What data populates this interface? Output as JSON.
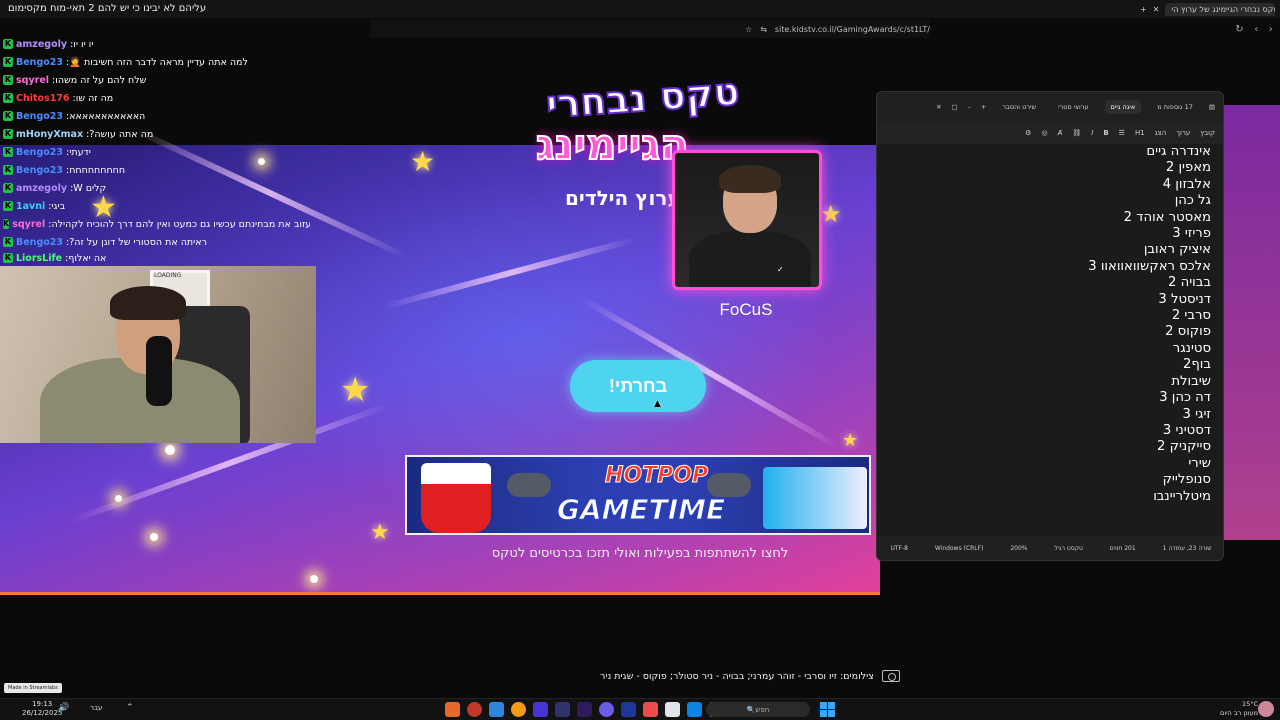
{
  "stream": {
    "title": "עליהם לא יבינו כי יש להם 2 תאי-מוח מקסימום",
    "credits": "צילומים: זיו וסרבי - זוהר עמרני; בבויה - ניר סטולר; פוקוס - שגית ניר"
  },
  "browser": {
    "tab_title": "טקס נבחרי הגיימינג של ערוץ הי",
    "url": "site.kidstv.co.il/GamingAwards/c/st1LT/"
  },
  "chat": [
    {
      "user": "amzegoly",
      "msg": "יו יו יו",
      "color": "#b58cff"
    },
    {
      "user": "Bengo23",
      "msg": "למה אתה עדיין מראה לדבר הזה חשיבות 🤦",
      "color": "#4a8cff"
    },
    {
      "user": "sqyrel",
      "msg": "שלח להם על זה משהו",
      "color": "#ff6bd6"
    },
    {
      "user": "Chitos176",
      "msg": "מה זה שו",
      "color": "#ff3a3a"
    },
    {
      "user": "Bengo23",
      "msg": "האאאאאאאאאאא",
      "color": "#4a8cff"
    },
    {
      "user": "mHonyXmax",
      "msg": "מה אתה עושה?",
      "color": "#9fd6ff"
    },
    {
      "user": "Bengo23",
      "msg": "ידעתי",
      "color": "#4a8cff"
    },
    {
      "user": "Bengo23",
      "msg": "חחחחחחחחח",
      "color": "#4a8cff"
    },
    {
      "user": "amzegoly",
      "msg": "W קלים",
      "color": "#b58cff"
    },
    {
      "user": "1avni",
      "msg": "ביגי",
      "color": "#3ad0ff"
    },
    {
      "user": "sqyrel",
      "msg": "עזוב את מבחינתם עכשיו גם כמעט ואין להם דרך להוכיח לקהילה",
      "color": "#ff6bd6"
    },
    {
      "user": "Bengo23",
      "msg": "ראיתה את הסטורי של דונן על זה?",
      "color": "#4a8cff"
    },
    {
      "user": "LiorsLife",
      "msg": "אה יאלוף",
      "color": "#4aff7a"
    }
  ],
  "game": {
    "logo_line1": "טקס נבחרי",
    "logo_line2": "הגיימינג",
    "logo_sub": "של ערוץ הילדים",
    "candidate_name": "FoCuS",
    "choose_button": "בחרתי!",
    "banner_brand": "HOTPOP",
    "banner_title": "GAMETIME",
    "banner_note": "לחצו להשתתפות בפעילות ואולי תזכו בכרטיסים לטקס"
  },
  "editor": {
    "tabs": [
      "17 גוספות מ",
      "איגה גיים",
      "ערוצי סטרי",
      "שירט והסבר"
    ],
    "active_tab": "איגה גיים",
    "menu": [
      "קובץ",
      "ערוך",
      "הצג"
    ],
    "heading_select": "H1",
    "lines": [
      "אינדרה גיים",
      "מאפין 2",
      "אלבזון 4",
      "גל כהן",
      "מאסטר אוהד 2",
      "פריזי 3",
      "איציק ראובן",
      "אלכס ראקשוואוואוו 3",
      "בבויה 2",
      "דניסטל 3",
      "סרבי 2",
      "פוקוס 2",
      "סטינגר",
      "בוף2",
      "שיבולת",
      "דה כהן 3",
      "זיגי 3",
      "דסטיני 3",
      "סייקניק 2",
      "שירי",
      "סנופלייק",
      "מיטלריינבו"
    ],
    "status": {
      "position": "שורה 23, עמודה 1",
      "chars": "201 תווים",
      "format": "טקסט רגיל",
      "zoom": "200%",
      "line_ending": "Windows (CRLF)",
      "encoding": "UTF-8"
    }
  },
  "taskbar": {
    "time": "19:13",
    "date": "26/12/2025",
    "lang": "עבר",
    "search_placeholder": "חפש",
    "weather_temp": "15°C",
    "weather_desc": "מעונן רב היום",
    "made_in": "Made in Streamlabs"
  },
  "webcam": {
    "loading": "LOADING"
  }
}
